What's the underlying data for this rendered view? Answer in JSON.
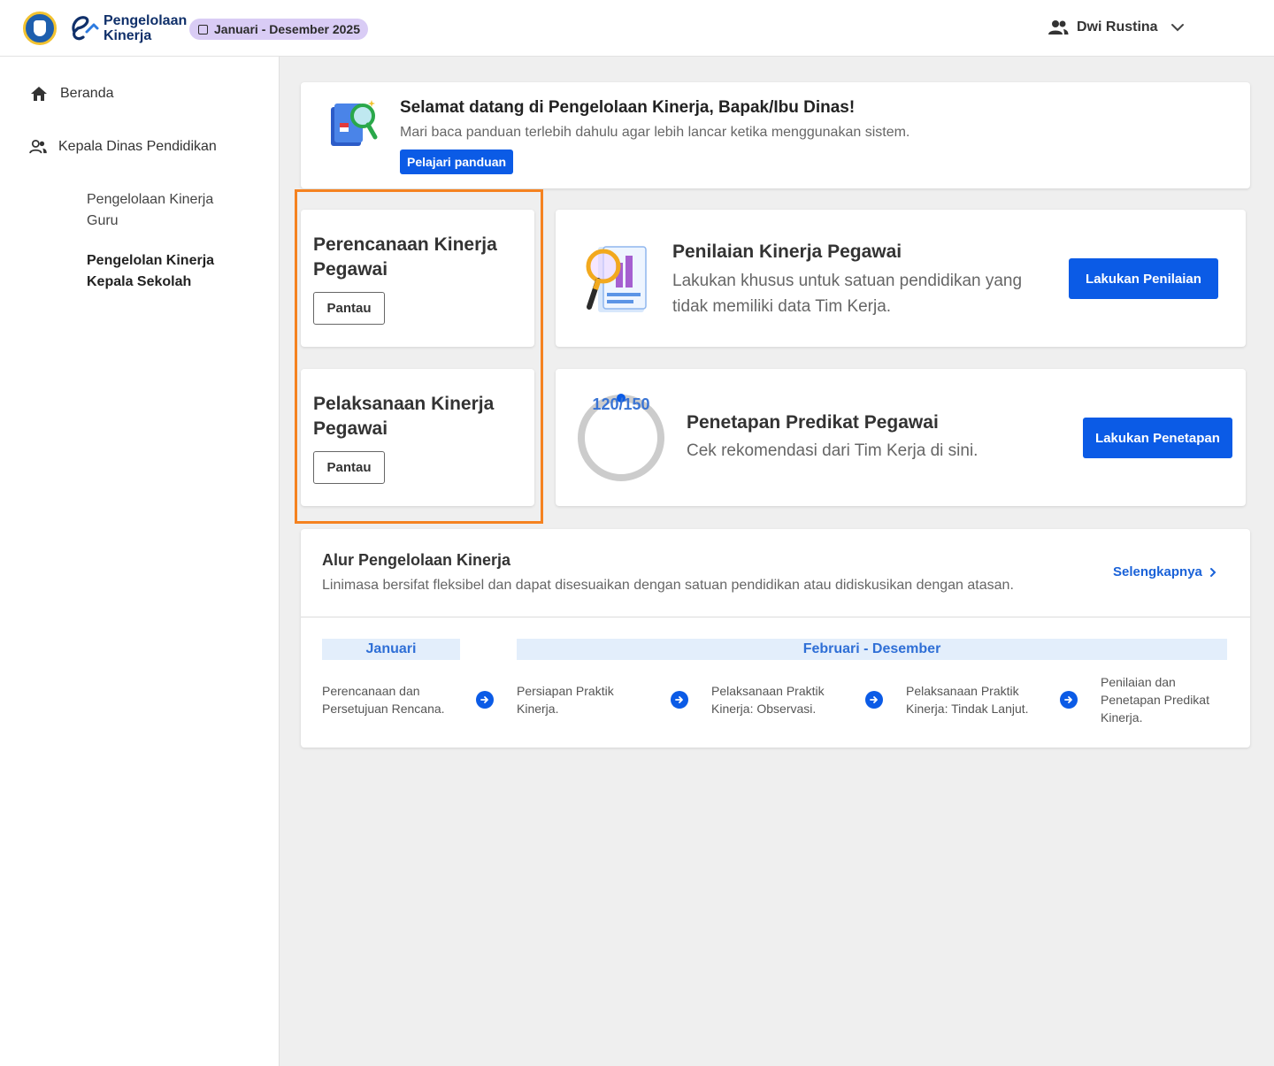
{
  "header": {
    "logo_line1": "Pengelolaan",
    "logo_line2": "Kinerja",
    "period": "Januari - Desember 2025",
    "user_name": "Dwi Rustina"
  },
  "sidebar": {
    "home": "Beranda",
    "role": "Kepala Dinas Pendidikan",
    "sub1": "Pengelolaan Kinerja Guru",
    "sub2": "Pengelolan Kinerja Kepala Sekolah"
  },
  "welcome": {
    "title": "Selamat datang di Pengelolaan Kinerja, Bapak/Ibu Dinas!",
    "subtitle": "Mari baca panduan terlebih dahulu agar lebih lancar ketika menggunakan sistem.",
    "button": "Pelajari panduan"
  },
  "planning": {
    "title": "Perencanaan Kinerja Pegawai",
    "button": "Pantau"
  },
  "execution": {
    "title": "Pelaksanaan Kinerja Pegawai",
    "button": "Pantau"
  },
  "assessment": {
    "title": "Penilaian Kinerja Pegawai",
    "subtitle": "Lakukan khusus untuk satuan pendidikan yang tidak memiliki data Tim Kerja.",
    "button": "Lakukan Penilaian"
  },
  "predicate": {
    "title": "Penetapan Predikat Pegawai",
    "subtitle": "Cek rekomendasi dari Tim Kerja di sini.",
    "button": "Lakukan Penetapan",
    "progress_label": "120/150",
    "progress_value": 120,
    "progress_total": 150
  },
  "flow": {
    "title": "Alur Pengelolaan Kinerja",
    "subtitle": "Linimasa bersifat fleksibel dan dapat disesuaikan dengan satuan pendidikan atau didiskusikan dengan atasan.",
    "more": "Selengkapnya",
    "phase1": "Januari",
    "phase2": "Februari - Desember",
    "steps": [
      "Perencanaan dan Persetujuan Rencana.",
      "Persiapan Praktik Kinerja.",
      "Pelaksanaan Praktik Kinerja: Observasi.",
      "Pelaksanaan Praktik Kinerja: Tindak Lanjut.",
      "Penilaian dan Penetapan Predikat Kinerja."
    ]
  },
  "colors": {
    "primary": "#0b5be6",
    "highlight": "#f58220",
    "period_pill": "#d9ccf5",
    "phase_bg": "#e3eefb"
  },
  "icons": {
    "logo": "kemendikbud-seal-icon",
    "home": "home-icon",
    "role": "people-icon",
    "user": "people-icon",
    "chevron": "chevron-down-icon",
    "more": "chevron-right-icon",
    "step_arrow": "arrow-right-circle-icon"
  }
}
